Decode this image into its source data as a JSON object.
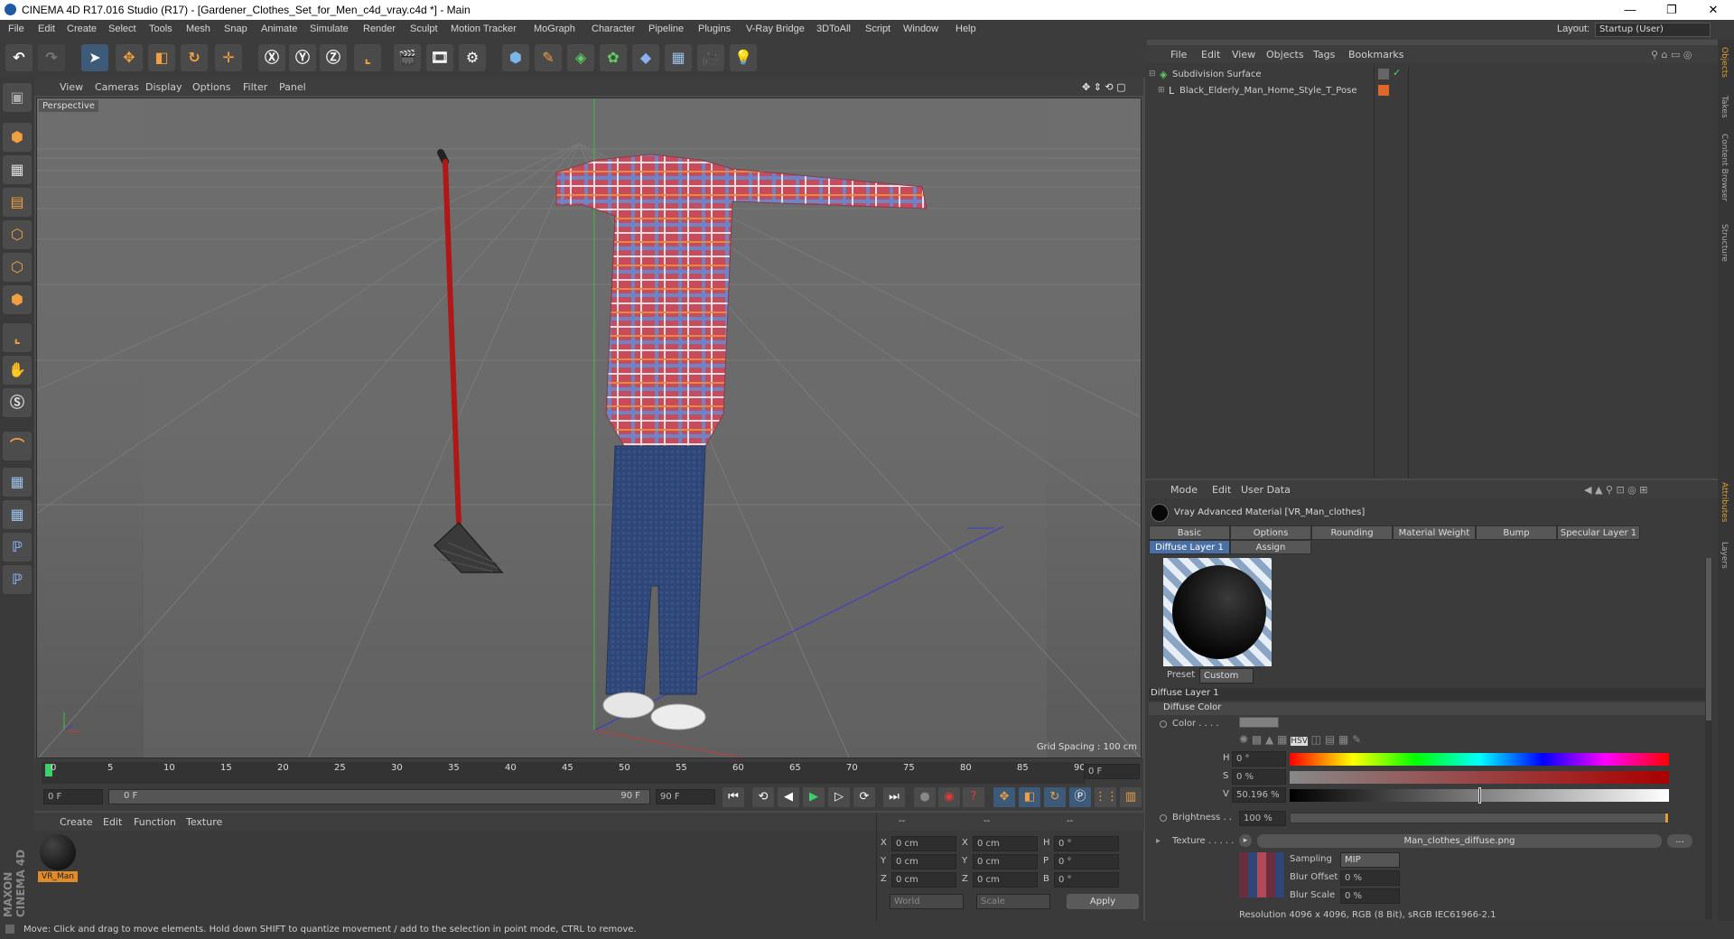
{
  "app": {
    "title": "CINEMA 4D R17.016 Studio (R17) - [Gardener_Clothes_Set_for_Men_c4d_vray.c4d *] - Main",
    "window_controls": [
      "—",
      "❐",
      "✕"
    ],
    "layout_label": "Layout:",
    "layout_value": "Startup (User)"
  },
  "menu": [
    "File",
    "Edit",
    "Create",
    "Select",
    "Tools",
    "Mesh",
    "Snap",
    "Animate",
    "Simulate",
    "Render",
    "Sculpt",
    "Motion Tracker",
    "MoGraph",
    "Character",
    "Pipeline",
    "Plugins",
    "V-Ray Bridge",
    "3DToAll",
    "Script",
    "Window",
    "Help"
  ],
  "viewport": {
    "menu": [
      "View",
      "Cameras",
      "Display",
      "Options",
      "Filter",
      "Panel"
    ],
    "label": "Perspective",
    "grid_spacing": "Grid Spacing : 100 cm"
  },
  "timeline": {
    "ticks": [
      "0",
      "5",
      "10",
      "15",
      "20",
      "25",
      "30",
      "35",
      "40",
      "45",
      "50",
      "55",
      "60",
      "65",
      "70",
      "75",
      "80",
      "85",
      "90"
    ],
    "current_frame": "0 F",
    "start_field": "0 F",
    "range_start": "0 F",
    "range_end": "90 F",
    "end_field": "90 F"
  },
  "material_manager": {
    "menu": [
      "Create",
      "Edit",
      "Function",
      "Texture"
    ],
    "material_name": "VR_Man"
  },
  "coords": {
    "header": [
      "--",
      "--",
      "--"
    ],
    "rows": [
      {
        "a": "X",
        "av": "0 cm",
        "b": "X",
        "bv": "0 cm",
        "c": "H",
        "cv": "0 °"
      },
      {
        "a": "Y",
        "av": "0 cm",
        "b": "Y",
        "bv": "0 cm",
        "c": "P",
        "cv": "0 °"
      },
      {
        "a": "Z",
        "av": "0 cm",
        "b": "Z",
        "bv": "0 cm",
        "c": "B",
        "cv": "0 °"
      }
    ],
    "world": "World",
    "scale": "Scale",
    "apply": "Apply"
  },
  "object_manager": {
    "menu": [
      "File",
      "Edit",
      "View",
      "Objects",
      "Tags",
      "Bookmarks"
    ],
    "objects": [
      "Subdivision Surface",
      "Black_Elderly_Man_Home_Style_T_Pose"
    ]
  },
  "attributes": {
    "menu": [
      "Mode",
      "Edit",
      "User Data"
    ],
    "material_title": "Vray Advanced Material [VR_Man_clothes]",
    "tabs_row1": [
      "Basic",
      "Options",
      "Rounding",
      "Material Weight",
      "Bump",
      "Specular Layer 1"
    ],
    "tabs_row2": [
      "Diffuse Layer 1",
      "Assign"
    ],
    "preset_label": "Preset",
    "preset_value": "Custom",
    "section": "Diffuse Layer 1",
    "subsection": "Diffuse Color",
    "color_label": "Color . . . .",
    "h_label": "H",
    "h_value": "0 °",
    "s_label": "S",
    "s_value": "0 %",
    "v_label": "V",
    "v_value": "50.196 %",
    "v_fraction": 0.50196,
    "brightness_label": "Brightness . .",
    "brightness_value": "100 %",
    "texture_label": "Texture . . . . .",
    "texture_file": "Man_clothes_diffuse.png",
    "texture_more": "...",
    "sampling_label": "Sampling",
    "sampling_value": "MIP",
    "blur_offset_label": "Blur Offset",
    "blur_offset_value": "0 %",
    "blur_scale_label": "Blur Scale",
    "blur_scale_value": "0 %",
    "resolution": "Resolution 4096 x 4096, RGB (8 Bit), sRGB IEC61966-2.1"
  },
  "side_tabs": [
    "Objects",
    "Takes",
    "Content Browser",
    "Structure",
    "Attributes",
    "Layers"
  ],
  "status": "Move: Click and drag to move elements. Hold down SHIFT to quantize movement / add to the selection in point mode, CTRL to remove.",
  "colors": {
    "accent": "#4a6fa5",
    "orange": "#e08a2a",
    "shirt": "#c24a5a",
    "jeans": "#2f4a7a"
  }
}
